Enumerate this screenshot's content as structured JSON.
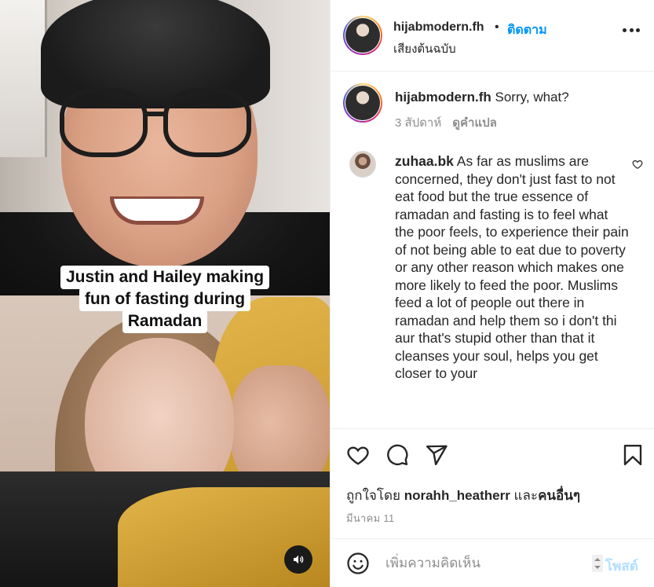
{
  "post": {
    "caption_lines": [
      "Justin and Hailey making",
      "fun of fasting during",
      "Ramadan"
    ]
  },
  "header": {
    "username": "hijabmodern.fh",
    "separator": "•",
    "follow_label": "ติดตาม",
    "audio_label": "เสียงต้นฉบับ",
    "more_icon": "more-horizontal-icon"
  },
  "comments": [
    {
      "username": "hijabmodern.fh",
      "text": "Sorry, what?",
      "time": "3 สัปดาห์",
      "translate_label": "ดูคำแปล"
    },
    {
      "username": "zuhaa.bk",
      "text": "As far as muslims are concerned, they don't just fast to not eat food but the true essence of ramadan and fasting is to feel what the poor feels, to experience their pain of not being able to eat due to poverty or any other reason which makes one more likely to feed the poor. Muslims feed a lot of people out there in ramadan and help them so i don't thi aur that's stupid other than that it cleanses your soul, helps you get closer to your"
    }
  ],
  "actions": {
    "icons": [
      "heart-icon",
      "comment-icon",
      "share-icon",
      "bookmark-icon"
    ],
    "likes_prefix": "ถูกใจโดย",
    "liked_by": "norahh_heatherr",
    "likes_conj": "และ",
    "likes_others": "คนอื่นๆ",
    "date": "มีนาคม 11"
  },
  "composer": {
    "placeholder": "เพิ่มความคิดเห็น",
    "post_label": "โพสต์"
  },
  "colors": {
    "accent": "#0095f6",
    "post_disabled": "#b2dffc",
    "muted": "#8e8e8e",
    "text": "#262626"
  }
}
